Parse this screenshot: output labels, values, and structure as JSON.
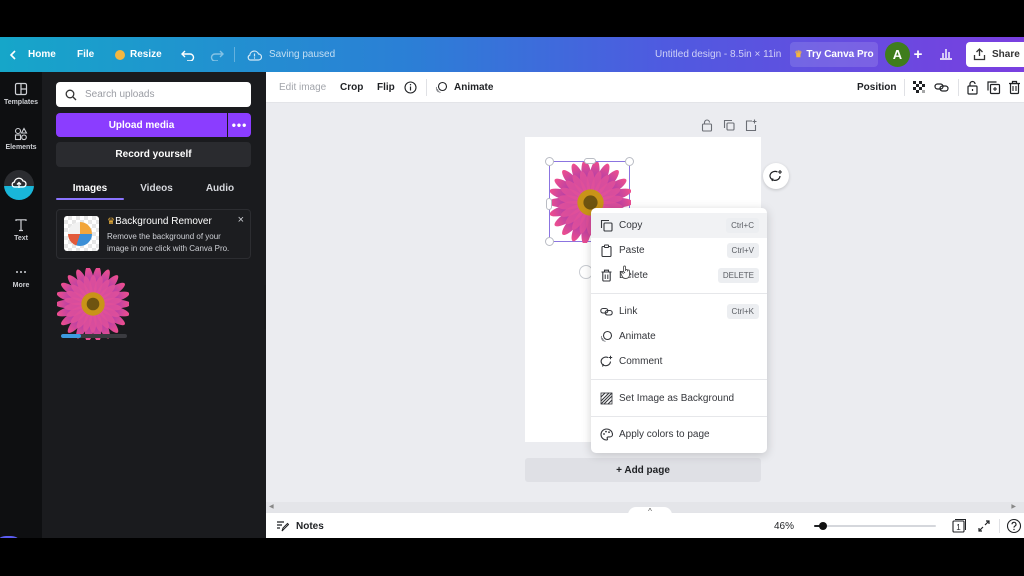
{
  "topbar": {
    "home": "Home",
    "file": "File",
    "resize": "Resize",
    "status": "Saving paused",
    "doc_title": "Untitled design - 8.5in × 11in",
    "try_pro": "Try Canva Pro",
    "avatar_initial": "A",
    "share": "Share",
    "colors": {
      "gradient_start": "#16a6c9",
      "gradient_end": "#7a3fe0",
      "avatar_bg": "#3f7d1c"
    }
  },
  "rail": {
    "items": [
      {
        "label": "Templates",
        "icon": "templates-icon"
      },
      {
        "label": "Elements",
        "icon": "elements-icon"
      },
      {
        "label": "Uploads",
        "icon": "upload-cloud-icon",
        "active": true
      },
      {
        "label": "Text",
        "icon": "text-icon"
      },
      {
        "label": "More",
        "icon": "more-icon"
      }
    ]
  },
  "panel": {
    "search_placeholder": "Search uploads",
    "search_value": "",
    "upload_media": "Upload media",
    "more_label": "•••",
    "record": "Record yourself",
    "tabs": [
      {
        "label": "Images",
        "active": true
      },
      {
        "label": "Videos",
        "active": false
      },
      {
        "label": "Audio",
        "active": false
      }
    ],
    "promo": {
      "title": "Background Remover",
      "text": "Remove the background of your image in one click with Canva Pro.",
      "close": "×"
    },
    "upload_progress_percent": 30,
    "accent": "#8b3dff"
  },
  "toolbar": {
    "edit_image": "Edit image",
    "crop": "Crop",
    "flip": "Flip",
    "animate": "Animate",
    "position": "Position"
  },
  "canvas": {
    "add_page": "+ Add page"
  },
  "context_menu": {
    "items": [
      {
        "label": "Copy",
        "shortcut": "Ctrl+C",
        "icon": "copy-icon",
        "hover": true
      },
      {
        "label": "Paste",
        "shortcut": "Ctrl+V",
        "icon": "paste-icon"
      },
      {
        "label": "Delete",
        "shortcut": "DELETE",
        "icon": "trash-icon"
      },
      {
        "label": "Link",
        "shortcut": "Ctrl+K",
        "icon": "link-icon"
      },
      {
        "label": "Animate",
        "shortcut": "",
        "icon": "animate-icon"
      },
      {
        "label": "Comment",
        "shortcut": "",
        "icon": "comment-icon"
      },
      {
        "label": "Set Image as Background",
        "shortcut": "",
        "icon": "background-icon"
      },
      {
        "label": "Apply colors to page",
        "shortcut": "",
        "icon": "palette-icon"
      }
    ]
  },
  "bottom": {
    "notes": "Notes",
    "zoom": "46%",
    "zoom_percent": 46,
    "page_count": "1"
  }
}
